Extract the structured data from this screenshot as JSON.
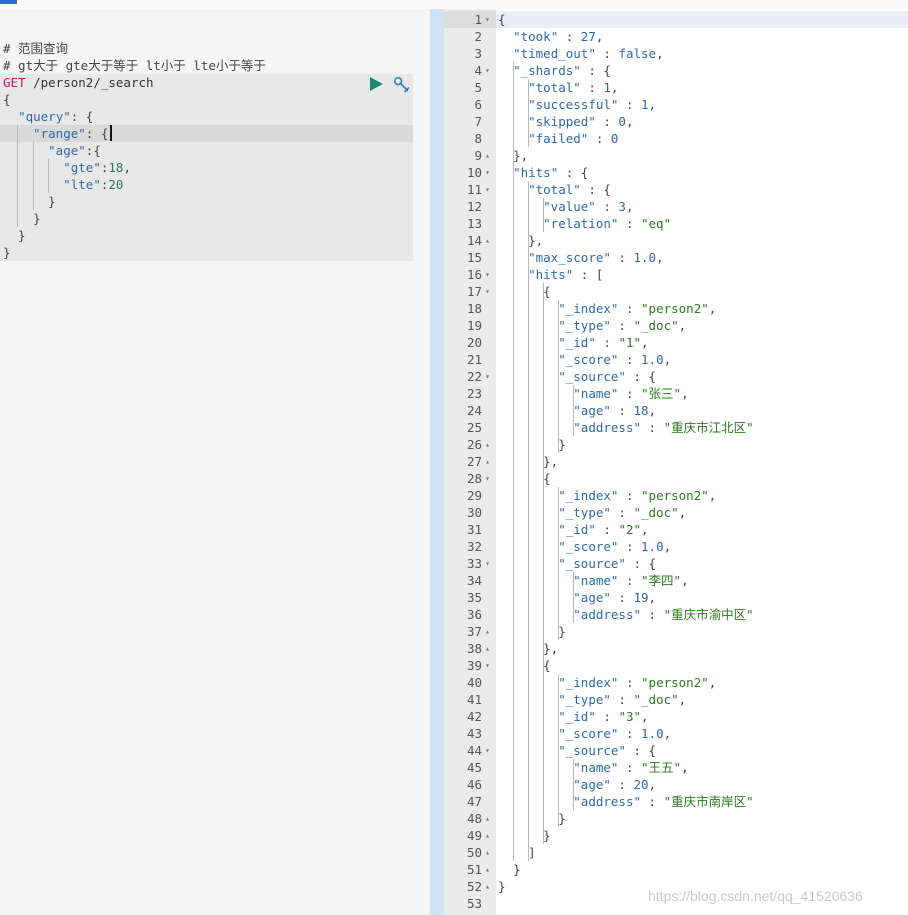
{
  "console": {
    "comment_1": "# 范围查询",
    "comment_2": "# gt大于 gte大于等于 lt小于 lte小于等于",
    "request_method": "GET",
    "request_path": "/person2/_search",
    "body": {
      "open_brace": "{",
      "query_key": "\"query\"",
      "range_key": "\"range\"",
      "age_key": "\"age\"",
      "gte_key": "\"gte\"",
      "gte_value": "18",
      "lte_key": "\"lte\"",
      "lte_value": "20",
      "close_brace": "}"
    },
    "run_icon": "play-icon",
    "settings_icon": "wrench-icon"
  },
  "response": {
    "line_numbers": [
      "1",
      "2",
      "3",
      "4",
      "5",
      "6",
      "7",
      "8",
      "9",
      "10",
      "11",
      "12",
      "13",
      "14",
      "15",
      "16",
      "17",
      "18",
      "19",
      "20",
      "21",
      "22",
      "23",
      "24",
      "25",
      "26",
      "27",
      "28",
      "29",
      "30",
      "31",
      "32",
      "33",
      "34",
      "35",
      "36",
      "37",
      "38",
      "39",
      "40",
      "41",
      "42",
      "43",
      "44",
      "45",
      "46",
      "47",
      "48",
      "49",
      "50",
      "51",
      "52",
      "53"
    ],
    "took": "27",
    "timed_out": "false",
    "shards": {
      "total": "1",
      "successful": "1",
      "skipped": "0",
      "failed": "0"
    },
    "hits_total": {
      "value": "3",
      "relation": "\"eq\""
    },
    "max_score": "1.0",
    "hits": [
      {
        "index": "\"person2\"",
        "type": "\"_doc\"",
        "id": "\"1\"",
        "score": "1.0",
        "name": "\"张三\"",
        "age": "18",
        "address": "\"重庆市江北区\""
      },
      {
        "index": "\"person2\"",
        "type": "\"_doc\"",
        "id": "\"2\"",
        "score": "1.0",
        "name": "\"李四\"",
        "age": "19",
        "address": "\"重庆市渝中区\""
      },
      {
        "index": "\"person2\"",
        "type": "\"_doc\"",
        "id": "\"3\"",
        "score": "1.0",
        "name": "\"王五\"",
        "age": "20",
        "address": "\"重庆市南岸区\""
      }
    ]
  },
  "watermark": "https://blog.csdn.net/qq_41520636",
  "colors": {
    "method": "#c41a5c",
    "key": "#2d6aa5",
    "string": "#2b7a1e",
    "run": "#1f8a70",
    "divider": "#cfe2f3"
  }
}
